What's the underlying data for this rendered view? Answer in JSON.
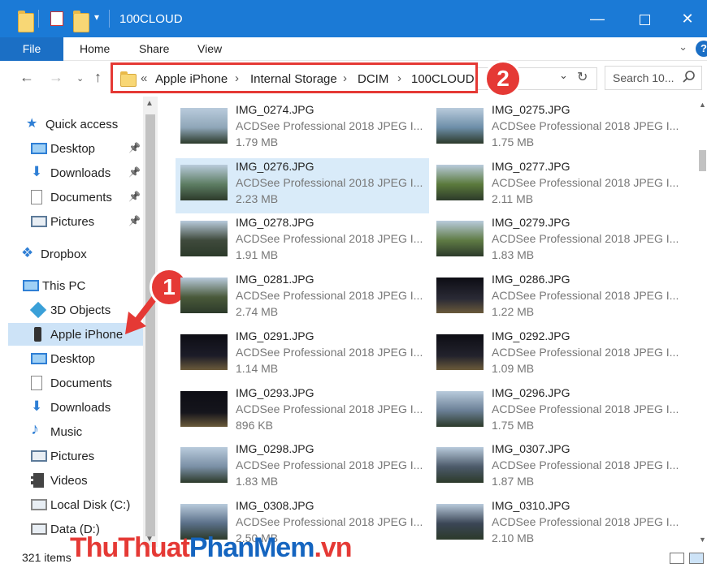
{
  "window": {
    "title": "100CLOUD",
    "minimize_icon": "minimize-icon",
    "maximize_icon": "maximize-icon",
    "close_icon": "close-icon"
  },
  "ribbon": {
    "tabs": [
      "File",
      "Home",
      "Share",
      "View"
    ],
    "help_label": "?"
  },
  "address": {
    "overflow": "«",
    "crumbs": [
      "Apple iPhone",
      "Internal Storage",
      "DCIM",
      "100CLOUD"
    ],
    "separator": "›"
  },
  "search": {
    "placeholder": "Search 10..."
  },
  "annotations": {
    "badge1": "1",
    "badge2": "2"
  },
  "nav": {
    "items": [
      {
        "label": "Quick access",
        "icon": "star-icon",
        "pinned": false
      },
      {
        "label": "Desktop",
        "icon": "desktop-icon",
        "pinned": true
      },
      {
        "label": "Downloads",
        "icon": "download-icon",
        "pinned": true
      },
      {
        "label": "Documents",
        "icon": "documents-icon",
        "pinned": true
      },
      {
        "label": "Pictures",
        "icon": "pictures-icon",
        "pinned": true
      },
      {
        "label": "Dropbox",
        "icon": "dropbox-icon",
        "pinned": false
      },
      {
        "label": "This PC",
        "icon": "computer-icon",
        "pinned": false
      },
      {
        "label": "3D Objects",
        "icon": "cube-icon",
        "pinned": false
      },
      {
        "label": "Apple iPhone",
        "icon": "phone-icon",
        "pinned": false,
        "selected": true
      },
      {
        "label": "Desktop",
        "icon": "desktop-icon",
        "pinned": false
      },
      {
        "label": "Documents",
        "icon": "documents-icon",
        "pinned": false
      },
      {
        "label": "Downloads",
        "icon": "download-icon",
        "pinned": false
      },
      {
        "label": "Music",
        "icon": "music-icon",
        "pinned": false
      },
      {
        "label": "Pictures",
        "icon": "pictures-icon",
        "pinned": false
      },
      {
        "label": "Videos",
        "icon": "video-icon",
        "pinned": false
      },
      {
        "label": "Local Disk (C:)",
        "icon": "disk-icon",
        "pinned": false
      },
      {
        "label": "Data (D:)",
        "icon": "drive-icon",
        "pinned": false
      }
    ]
  },
  "files": [
    {
      "name": "IMG_0274.JPG",
      "type": "ACDSee Professional 2018 JPEG I...",
      "size": "1.79 MB",
      "tone": "#8fa6b8"
    },
    {
      "name": "IMG_0275.JPG",
      "type": "ACDSee Professional 2018 JPEG I...",
      "size": "1.75 MB",
      "tone": "#6d8ea8"
    },
    {
      "name": "IMG_0276.JPG",
      "type": "ACDSee Professional 2018 JPEG I...",
      "size": "2.23 MB",
      "tone": "#5d7d63",
      "selected": true
    },
    {
      "name": "IMG_0277.JPG",
      "type": "ACDSee Professional 2018 JPEG I...",
      "size": "2.11 MB",
      "tone": "#5b7a3c"
    },
    {
      "name": "IMG_0278.JPG",
      "type": "ACDSee Professional 2018 JPEG I...",
      "size": "1.91 MB",
      "tone": "#3f4a3c"
    },
    {
      "name": "IMG_0279.JPG",
      "type": "ACDSee Professional 2018 JPEG I...",
      "size": "1.83 MB",
      "tone": "#5f7b45"
    },
    {
      "name": "IMG_0281.JPG",
      "type": "ACDSee Professional 2018 JPEG I...",
      "size": "2.74 MB",
      "tone": "#4a5a3a"
    },
    {
      "name": "IMG_0286.JPG",
      "type": "ACDSee Professional 2018 JPEG I...",
      "size": "1.22 MB",
      "tone": "#2a2a35"
    },
    {
      "name": "IMG_0291.JPG",
      "type": "ACDSee Professional 2018 JPEG I...",
      "size": "1.14 MB",
      "tone": "#1c1c28"
    },
    {
      "name": "IMG_0292.JPG",
      "type": "ACDSee Professional 2018 JPEG I...",
      "size": "1.09 MB",
      "tone": "#22222c"
    },
    {
      "name": "IMG_0293.JPG",
      "type": "ACDSee Professional 2018 JPEG I...",
      "size": "896 KB",
      "tone": "#15151c"
    },
    {
      "name": "IMG_0296.JPG",
      "type": "ACDSee Professional 2018 JPEG I...",
      "size": "1.75 MB",
      "tone": "#6a7f95"
    },
    {
      "name": "IMG_0298.JPG",
      "type": "ACDSee Professional 2018 JPEG I...",
      "size": "1.83 MB",
      "tone": "#7a8fa5"
    },
    {
      "name": "IMG_0307.JPG",
      "type": "ACDSee Professional 2018 JPEG I...",
      "size": "1.87 MB",
      "tone": "#4c5a6a"
    },
    {
      "name": "IMG_0308.JPG",
      "type": "ACDSee Professional 2018 JPEG I...",
      "size": "2.50 MB",
      "tone": "#5a6f88"
    },
    {
      "name": "IMG_0310.JPG",
      "type": "ACDSee Professional 2018 JPEG I...",
      "size": "2.10 MB",
      "tone": "#3b4656"
    }
  ],
  "status": {
    "count": "321 items"
  },
  "watermark": {
    "part1": "ThuThuat",
    "part2": "PhanMem",
    "part3": ".vn"
  },
  "colors": {
    "titlebar": "#1b7ad6",
    "highlight": "#e53935",
    "selection": "#cde3f7"
  }
}
